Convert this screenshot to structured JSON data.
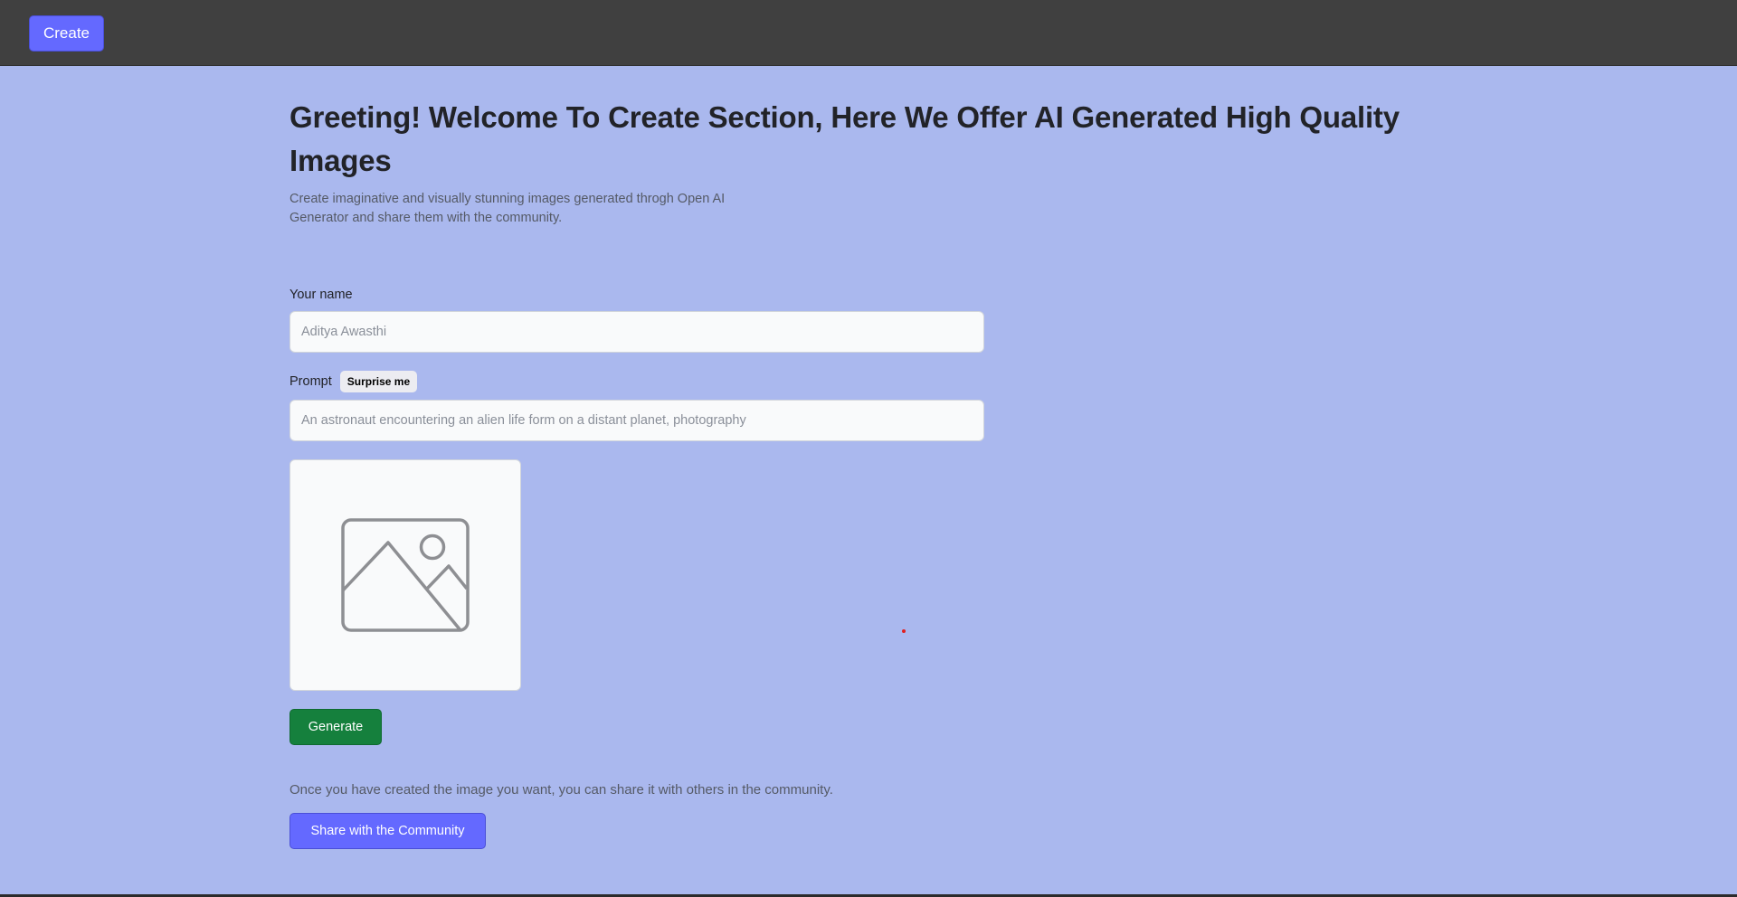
{
  "header": {
    "create_label": "Create"
  },
  "main": {
    "title": "Greeting! Welcome To Create Section, Here We Offer AI Generated High Quality Images",
    "subtitle": "Create imaginative and visually stunning images generated throgh Open AI Generator and share them with the community.",
    "form": {
      "name_label": "Your name",
      "name_placeholder": "Aditya Awasthi",
      "prompt_label": "Prompt",
      "surprise_label": "Surprise me",
      "prompt_placeholder": "An astronaut encountering an alien life form on a distant planet, photography"
    },
    "preview": {
      "icon": "image-placeholder-icon"
    },
    "generate_label": "Generate",
    "share_text": "Once you have created the image you want, you can share it with others in the community.",
    "share_label": "Share with the Community"
  },
  "colors": {
    "page_background": "#aab8ee",
    "topbar": "#404040",
    "accent": "#6469ff",
    "generate": "#15803d"
  }
}
